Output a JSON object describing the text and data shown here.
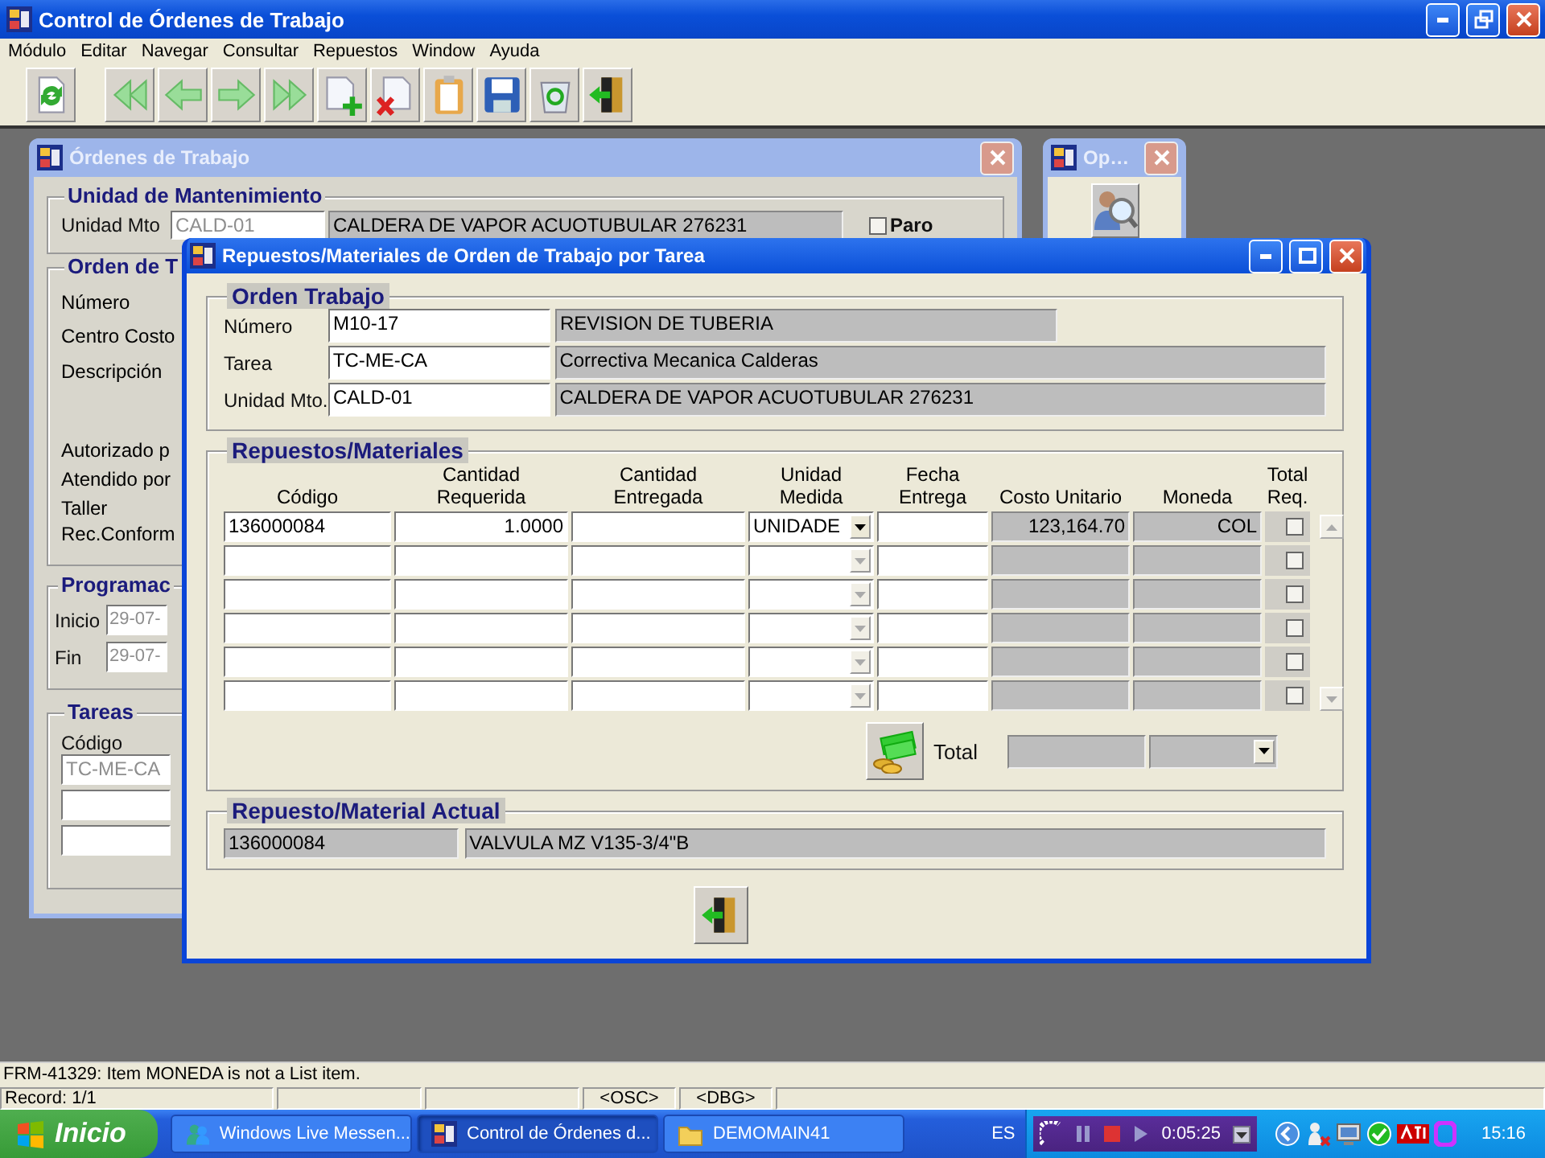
{
  "app": {
    "title": "Control de Órdenes de Trabajo"
  },
  "menu": [
    {
      "label": "Módulo"
    },
    {
      "label": "Editar"
    },
    {
      "label": "Navegar"
    },
    {
      "label": "Consultar"
    },
    {
      "label": "Repuestos"
    },
    {
      "label": "Window"
    },
    {
      "label": "Ayuda"
    }
  ],
  "toolbar": [
    {
      "kind": "reload"
    },
    {
      "kind": "first"
    },
    {
      "kind": "prev"
    },
    {
      "kind": "next"
    },
    {
      "kind": "last"
    },
    {
      "kind": "insert"
    },
    {
      "kind": "remove"
    },
    {
      "kind": "clipboard"
    },
    {
      "kind": "save"
    },
    {
      "kind": "recycle"
    },
    {
      "kind": "exit"
    }
  ],
  "orders_window": {
    "title": "Órdenes de Trabajo",
    "unit_heading": "Unidad de Mantenimiento",
    "unit_label": "Unidad Mto",
    "unit_code": "CALD-01",
    "unit_name": "CALDERA DE VAPOR ACUOTUBULAR 276231",
    "stop": {
      "label": "Paro",
      "checked": false
    },
    "order_heading": "Orden de T",
    "order_labels": [
      "Número",
      "Centro Costo",
      "Descripción",
      "Autorizado p",
      "Atendido por",
      "Taller",
      "Rec.Conform"
    ],
    "schedule_heading": "Programac",
    "schedule": [
      {
        "label": "Inicio",
        "value": "29-07-"
      },
      {
        "label": "Fin",
        "value": "29-07-"
      }
    ],
    "tasks_heading": "Tareas",
    "tasks_label": "Código",
    "tasks": [
      "TC-ME-CA"
    ]
  },
  "options_window": {
    "title": "Op…"
  },
  "parts_window": {
    "title": "Repuestos/Materiales de Orden de Trabajo por Tarea",
    "order_heading": "Orden Trabajo",
    "order_fields": [
      {
        "label": "Número",
        "code": "M10-17",
        "name": "REVISION DE TUBERIA"
      },
      {
        "label": "Tarea",
        "code": "TC-ME-CA",
        "name": "Correctiva Mecanica Calderas"
      },
      {
        "label": "Unidad Mto.",
        "code": "CALD-01",
        "name": "CALDERA DE VAPOR ACUOTUBULAR 276231"
      }
    ],
    "parts_heading": "Repuestos/Materiales",
    "columns": [
      "Código",
      "Cantidad\nRequerida",
      "Cantidad\nEntregada",
      "Unidad\nMedida",
      "Fecha\nEntrega",
      "Costo Unitario",
      "Moneda",
      "Total\nReq."
    ],
    "rows": [
      {
        "code": "136000084",
        "qty_requested": "1.0000",
        "unit": "UNIDADE",
        "unit_cost": "123,164.70",
        "currency": "COL",
        "total_req": false
      },
      {
        "total_req": false
      },
      {
        "total_req": false
      },
      {
        "total_req": false
      },
      {
        "total_req": false
      },
      {
        "total_req": false
      }
    ],
    "total_label": "Total",
    "current_heading": "Repuesto/Material Actual",
    "current": {
      "code": "136000084",
      "name": "VALVULA MZ V135-3/4\"B"
    }
  },
  "status": {
    "message": "FRM-41329: Item MONEDA is not a List item.",
    "record": "Record: 1/1",
    "flags": [
      "<OSC>",
      "<DBG>"
    ]
  },
  "taskbar": {
    "start": "Inicio",
    "tasks": [
      {
        "kind": "messenger",
        "label": "Windows Live Messen...",
        "selected": false
      },
      {
        "kind": "forms",
        "label": "Control de Órdenes d...",
        "selected": true
      },
      {
        "kind": "folder",
        "label": "DEMOMAIN41",
        "selected": false
      }
    ],
    "language": "ES",
    "media_time": "0:05:25",
    "clock": "15:16"
  }
}
